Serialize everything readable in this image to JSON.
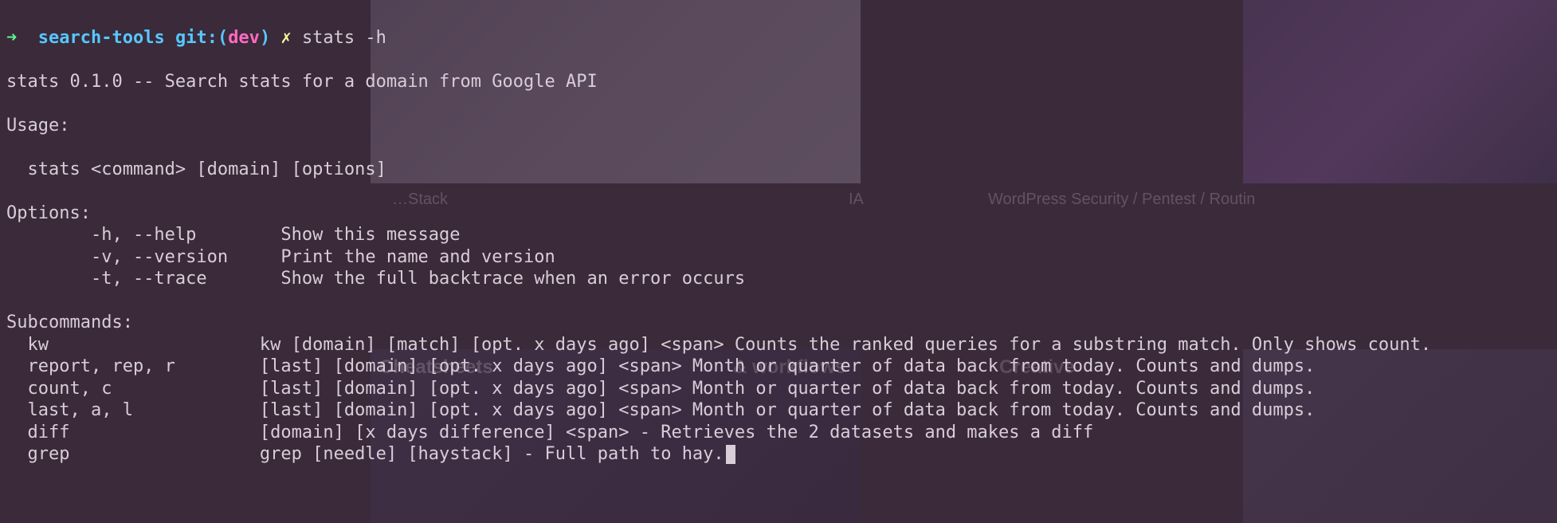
{
  "prompt": {
    "arrow": "➜",
    "dir": "search-tools",
    "git_label": "git:",
    "paren_open": "(",
    "branch": "dev",
    "paren_close": ")",
    "dirty": "✗",
    "command": "stats -h"
  },
  "output": {
    "header": "stats 0.1.0 -- Search stats for a domain from Google API",
    "blank1": "",
    "usage_label": "Usage:",
    "blank2": "",
    "usage_line": "  stats <command> [domain] [options]",
    "blank3": "",
    "options_label": "Options:",
    "opt_help": "        -h, --help        Show this message",
    "opt_version": "        -v, --version     Print the name and version",
    "opt_trace": "        -t, --trace       Show the full backtrace when an error occurs",
    "blank4": "",
    "subcmd_label": "Subcommands:",
    "sub_kw": "  kw                    kw [domain] [match] [opt. x days ago] <span> Counts the ranked queries for a substring match. Only shows count.",
    "sub_report": "  report, rep, r        [last] [domain] [opt. x days ago] <span> Month or quarter of data back from today. Counts and dumps.",
    "sub_count": "  count, c              [last] [domain] [opt. x days ago] <span> Month or quarter of data back from today. Counts and dumps.",
    "sub_last": "  last, a, l            [last] [domain] [opt. x days ago] <span> Month or quarter of data back from today. Counts and dumps.",
    "sub_diff": "  diff                  [domain] [x days difference] <span> - Retrieves the 2 datasets and makes a diff",
    "sub_grep": "  grep                  grep [needle] [haystack] - Full path to hay."
  },
  "bg": {
    "stack": "…Stack",
    "ia": "IA",
    "wordpress": "WordPress Security / Pentest / Routin",
    "cheatsheets": "Cheatsheets",
    "workflows": "& workflows",
    "creative": "Creative"
  }
}
